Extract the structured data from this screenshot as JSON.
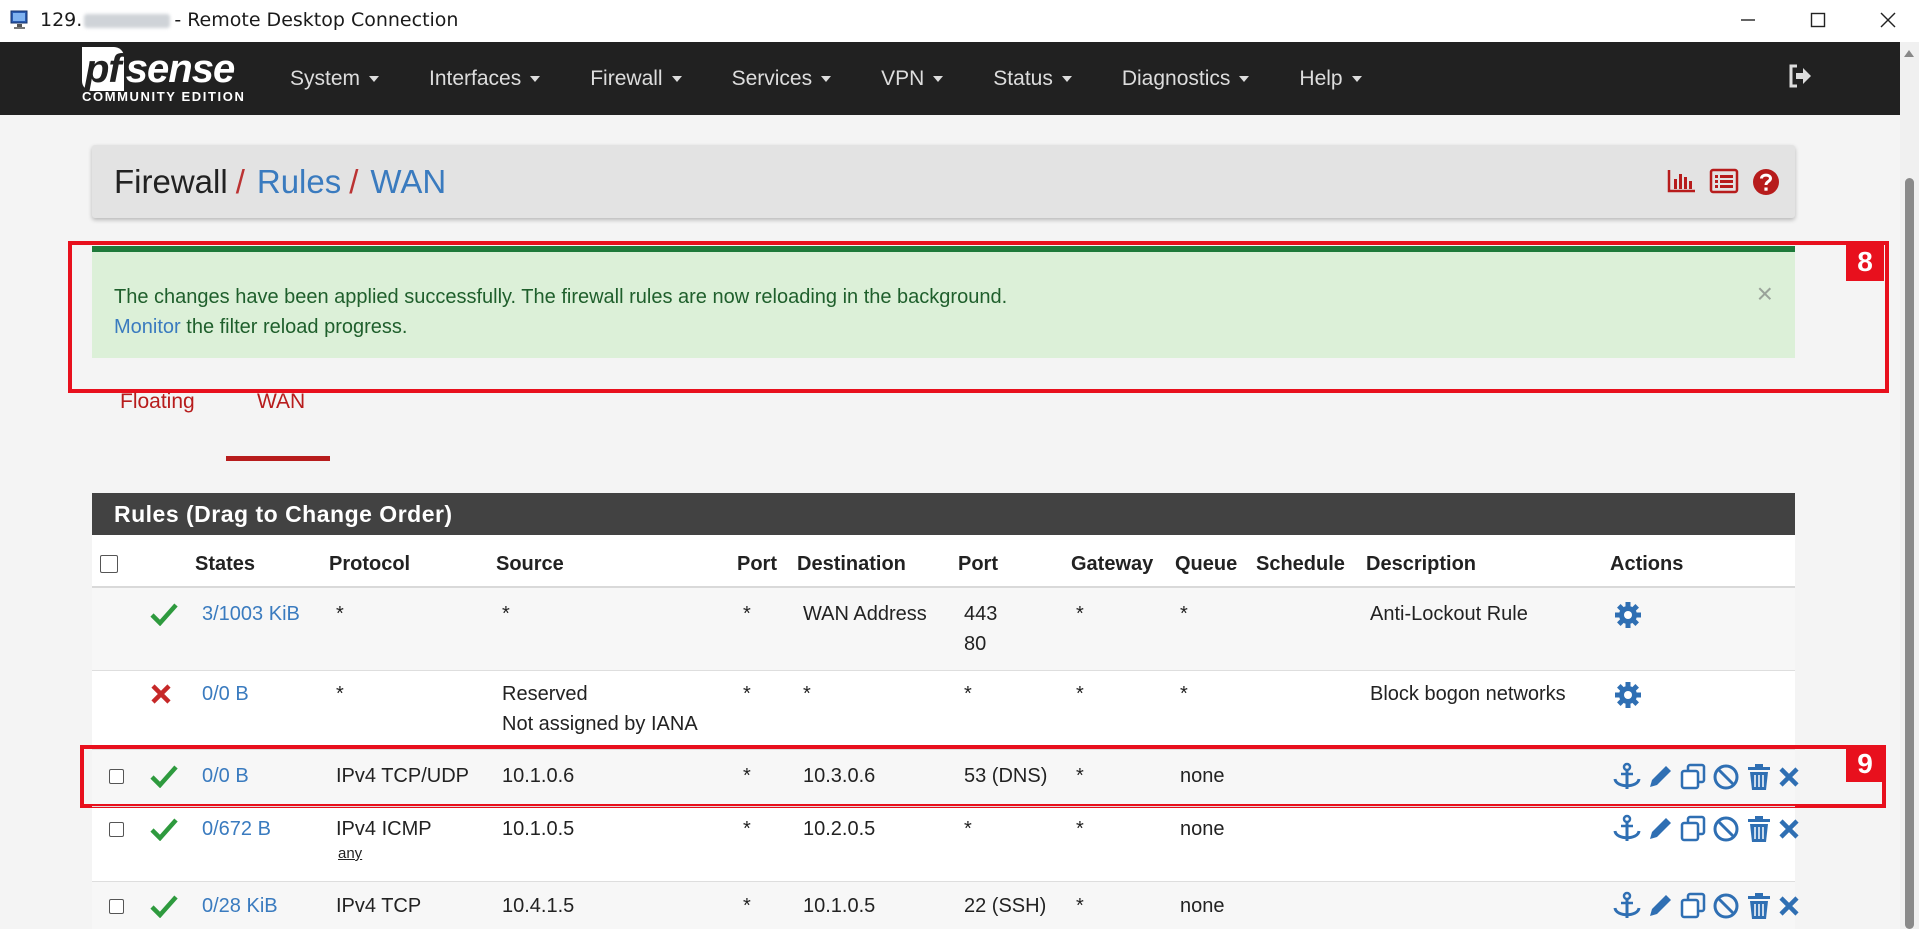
{
  "window": {
    "title_prefix": "129.",
    "title_suffix": "- Remote Desktop Connection"
  },
  "navbar": {
    "logo_main_pf": "pf",
    "logo_main_rest": "sense",
    "logo_sub": "COMMUNITY EDITION",
    "menu": [
      "System",
      "Interfaces",
      "Firewall",
      "Services",
      "VPN",
      "Status",
      "Diagnostics",
      "Help"
    ]
  },
  "breadcrumb": {
    "first": "Firewall",
    "second": "Rules",
    "third": "WAN",
    "separator": "/"
  },
  "alert": {
    "line1": "The changes have been applied successfully. The firewall rules are now reloading in the background.",
    "link": "Monitor",
    "line2_rest": " the filter reload progress.",
    "close": "×"
  },
  "markers": {
    "alert": "8",
    "row": "9"
  },
  "tabs": [
    "Floating",
    "WAN"
  ],
  "active_tab": "WAN",
  "rules_panel": {
    "title": "Rules (Drag to Change Order)",
    "columns": {
      "states": "States",
      "protocol": "Protocol",
      "source": "Source",
      "src_port": "Port",
      "destination": "Destination",
      "dst_port": "Port",
      "gateway": "Gateway",
      "queue": "Queue",
      "schedule": "Schedule",
      "description": "Description",
      "actions": "Actions"
    },
    "rows": [
      {
        "status": "pass",
        "states": "3/1003 KiB",
        "protocol": "*",
        "protocol_sub": "",
        "source": "*",
        "source2": "",
        "src_port": "*",
        "destination": "WAN Address",
        "dst_port": "443",
        "dst_port2": "80",
        "gateway": "*",
        "queue": "*",
        "schedule": "",
        "description": "Anti-Lockout Rule"
      },
      {
        "status": "block",
        "states": "0/0 B",
        "protocol": "*",
        "protocol_sub": "",
        "source": "Reserved",
        "source2": "Not assigned by IANA",
        "src_port": "*",
        "destination": "*",
        "dst_port": "*",
        "dst_port2": "",
        "gateway": "*",
        "queue": "*",
        "schedule": "",
        "description": "Block bogon networks"
      },
      {
        "status": "pass",
        "states": "0/0 B",
        "protocol": "IPv4 TCP/UDP",
        "protocol_sub": "",
        "source": "10.1.0.6",
        "source2": "",
        "src_port": "*",
        "destination": "10.3.0.6",
        "dst_port": "53 (DNS)",
        "dst_port2": "",
        "gateway": "*",
        "queue": "none",
        "schedule": "",
        "description": ""
      },
      {
        "status": "pass",
        "states": "0/672 B",
        "protocol": "IPv4 ICMP",
        "protocol_sub": "any",
        "source": "10.1.0.5",
        "source2": "",
        "src_port": "*",
        "destination": "10.2.0.5",
        "dst_port": "*",
        "dst_port2": "",
        "gateway": "*",
        "queue": "none",
        "schedule": "",
        "description": ""
      },
      {
        "status": "pass",
        "states": "0/28 KiB",
        "protocol": "IPv4 TCP",
        "protocol_sub": "",
        "source": "10.4.1.5",
        "source2": "",
        "src_port": "*",
        "destination": "10.1.0.5",
        "dst_port": "22 (SSH)",
        "dst_port2": "",
        "gateway": "*",
        "queue": "none",
        "schedule": "",
        "description": ""
      }
    ]
  },
  "colors": {
    "navbar": "#212121",
    "accent_red": "#b71c1c",
    "link_blue": "#3a7bbf",
    "pass_green": "#2e9a3e",
    "block_red": "#c62828",
    "alert_bg": "#dcf0d8",
    "marker_red": "#e8101d"
  }
}
